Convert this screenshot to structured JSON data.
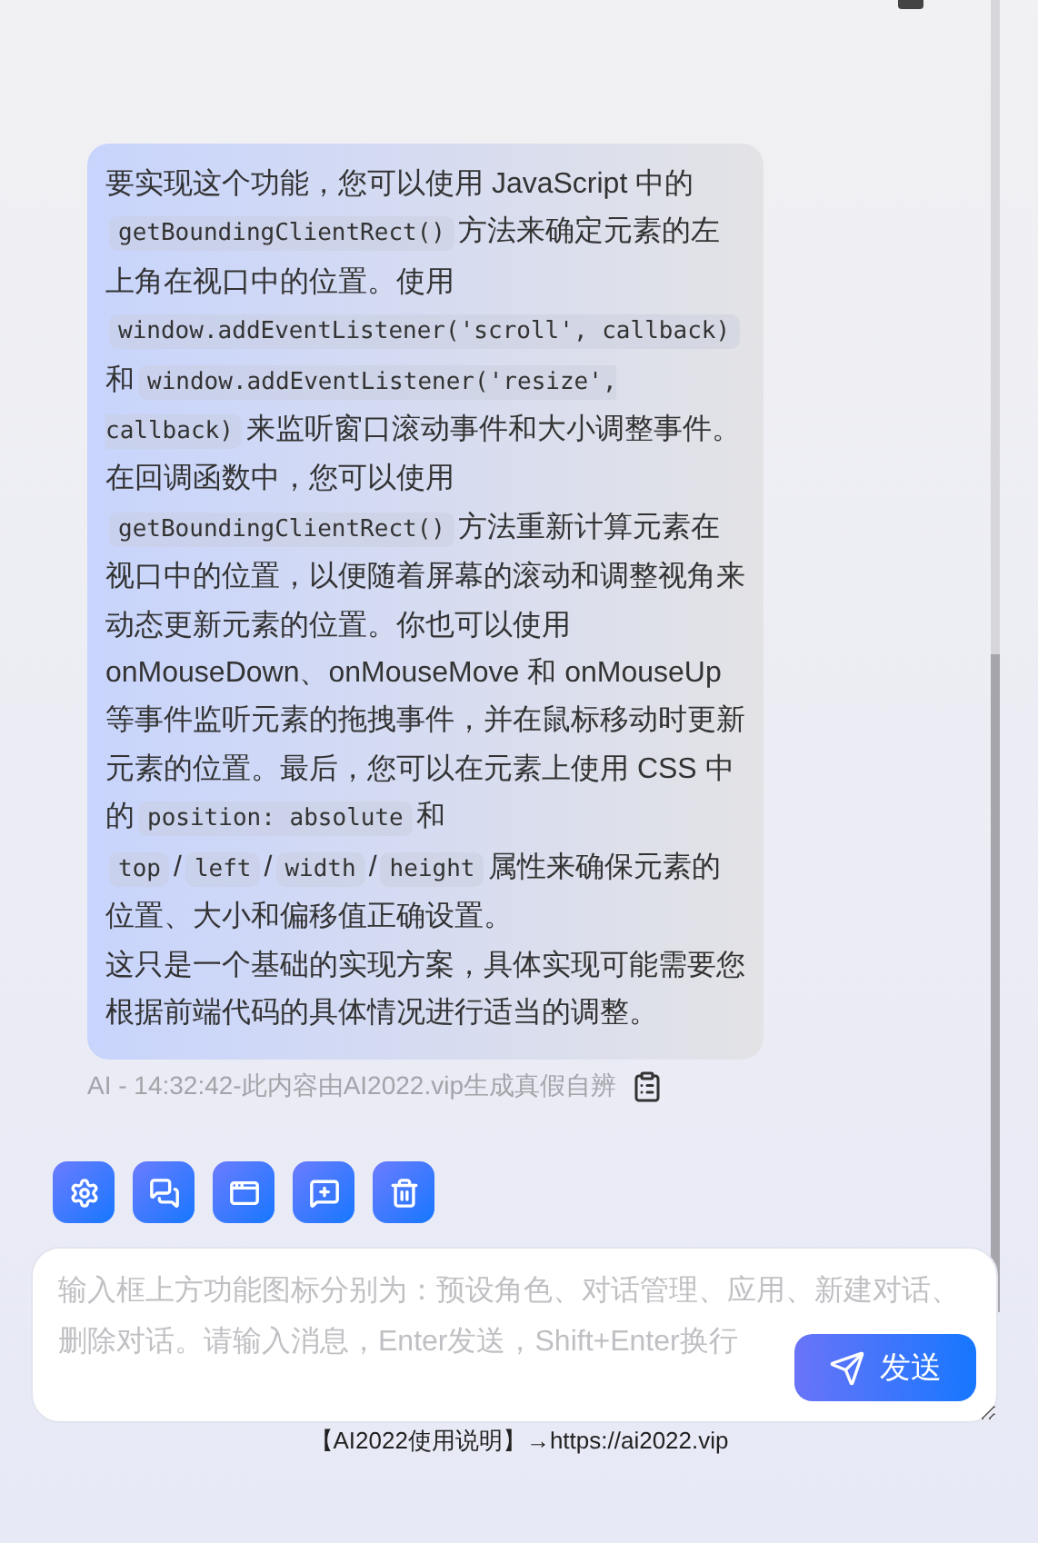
{
  "message": {
    "paragraphs": [
      {
        "segments": [
          {
            "kind": "text",
            "text": "要实现这个功能，您可以使用 JavaScript 中的"
          },
          {
            "kind": "code",
            "text": "getBoundingClientRect()"
          },
          {
            "kind": "text",
            "text": "方法来确定元素的左上角在视口中的位置。使用"
          },
          {
            "kind": "code",
            "text": "window.addEventListener('scroll', callback)"
          },
          {
            "kind": "text",
            "text": "和"
          },
          {
            "kind": "code",
            "text": "window.addEventListener('resize', callback)"
          },
          {
            "kind": "text",
            "text": "来监听窗口滚动事件和大小调整事件。在回调函数中，您可以使用"
          },
          {
            "kind": "code",
            "text": "getBoundingClientRect()"
          },
          {
            "kind": "text",
            "text": "方法重新计算元素在视口中的位置，以便随着屏幕的滚动和调整视角来动态更新元素的位置。你也可以使用 onMouseDown、onMouseMove 和 onMouseUp 等事件监听元素的拖拽事件，并在鼠标移动时更新元素的位置。最后，您可以在元素上使用 CSS 中的"
          },
          {
            "kind": "code",
            "text": "position: absolute"
          },
          {
            "kind": "text",
            "text": "和"
          },
          {
            "kind": "code",
            "text": "top"
          },
          {
            "kind": "text",
            "text": "/"
          },
          {
            "kind": "code",
            "text": "left"
          },
          {
            "kind": "text",
            "text": "/"
          },
          {
            "kind": "code",
            "text": "width"
          },
          {
            "kind": "text",
            "text": "/"
          },
          {
            "kind": "code",
            "text": "height"
          },
          {
            "kind": "text",
            "text": "属性来确保元素的位置、大小和偏移值正确设置。"
          }
        ]
      },
      {
        "segments": [
          {
            "kind": "text",
            "text": "这只是一个基础的实现方案，具体实现可能需要您根据前端代码的具体情况进行适当的调整。"
          }
        ]
      }
    ],
    "meta": "AI - 14:32:42-此内容由AI2022.vip生成真假自辨"
  },
  "toolbar": [
    {
      "kind": "settings"
    },
    {
      "kind": "chats"
    },
    {
      "kind": "apps"
    },
    {
      "kind": "new"
    },
    {
      "kind": "delete"
    }
  ],
  "input": {
    "placeholder": "输入框上方功能图标分别为：预设角色、对话管理、应用、新建对话、删除对话。请输入消息，Enter发送，Shift+Enter换行"
  },
  "send_button": "发送",
  "footer": "【AI2022使用说明】→https://ai2022.vip"
}
